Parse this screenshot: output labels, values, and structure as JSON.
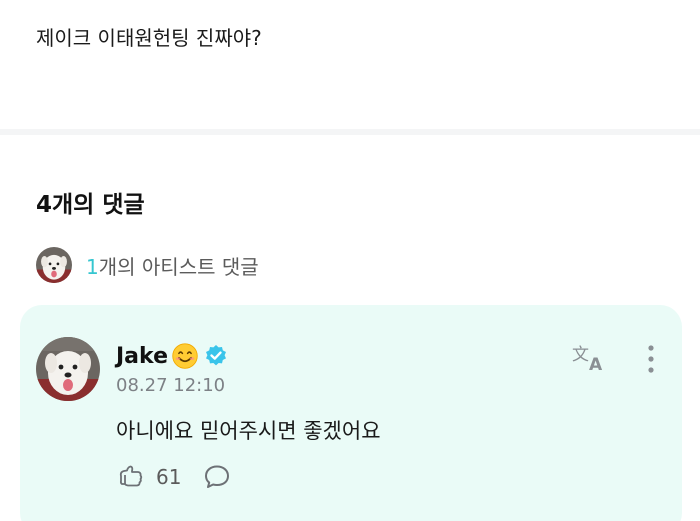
{
  "post": {
    "text": "제이크 이태원헌팅 진짜야?"
  },
  "comments": {
    "title": "4개의 댓글",
    "artist_summary": {
      "count": "1",
      "suffix": "개의 아티스트 댓글"
    },
    "items": [
      {
        "author": "Jake",
        "emoji": "smiling-face-emoji",
        "verified": true,
        "date": "08.27 12:10",
        "body": "아니에요 믿어주시면 좋겠어요",
        "likes": "61"
      }
    ]
  },
  "colors": {
    "accent": "#35c6d0",
    "card_background": "#eafbf7",
    "verified": "#3ac4ea"
  },
  "icons": {
    "translate": "translate-icon",
    "more": "more-vertical-icon",
    "like": "like-icon",
    "reply": "comment-bubble-icon"
  }
}
